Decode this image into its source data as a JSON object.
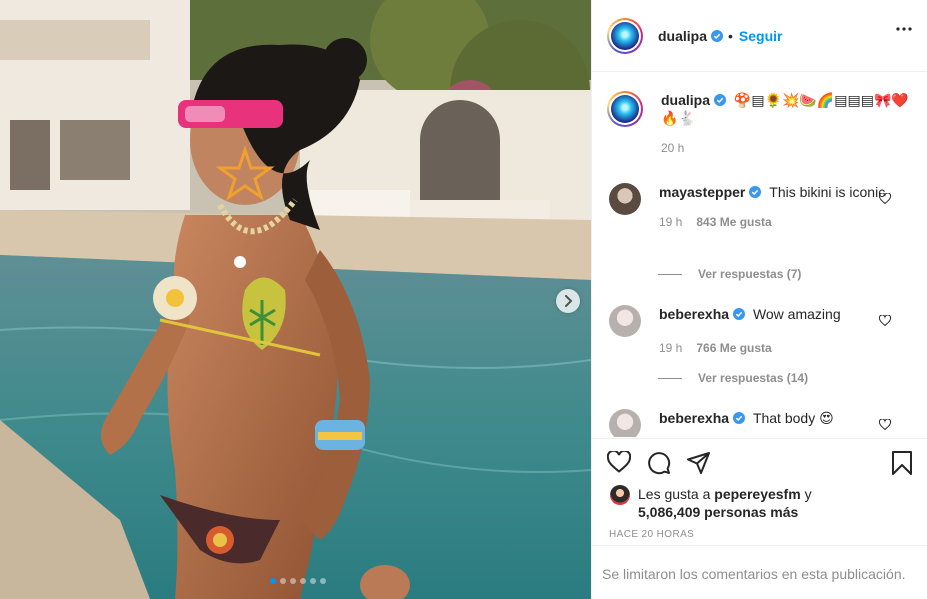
{
  "post": {
    "username": "dualipa",
    "separator": "•",
    "follow_label": "Seguir",
    "verified_color": "#3897f0",
    "accent_color": "#0095f6"
  },
  "media": {
    "carousel_count": 6,
    "active_index": 0,
    "next_icon": "chevron-right-icon"
  },
  "caption": {
    "username": "dualipa",
    "text": "🍄▤🌻💥🍉🌈▤▤▤🎀❤️🔥🐇",
    "time": "20 h"
  },
  "comments": [
    {
      "username": "mayastepper",
      "text": "This bikini is iconic",
      "time": "19 h",
      "likes": "843 Me gusta",
      "replies": "Ver respuestas (7)"
    },
    {
      "username": "beberexha",
      "text": "Wow amazing",
      "time": "19 h",
      "likes": "766 Me gusta",
      "replies": "Ver respuestas (14)"
    },
    {
      "username": "beberexha",
      "text": "That body 😍"
    }
  ],
  "likes": {
    "prefix": "Les gusta a",
    "liker": "pepereyesfm",
    "conj": "y",
    "count_text": "5,086,409 personas más"
  },
  "timestamp": "HACE 20 HORAS",
  "comments_limited": "Se limitaron los comentarios en esta publicación."
}
